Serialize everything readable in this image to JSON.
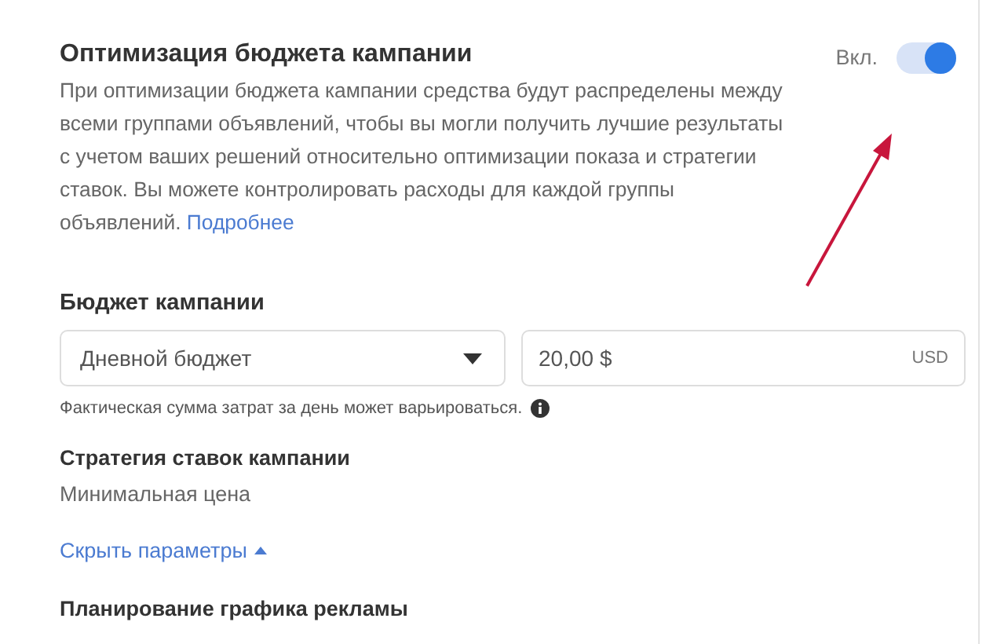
{
  "cbo": {
    "title": "Оптимизация бюджета кампании",
    "toggle_label": "Вкл.",
    "on": true,
    "description": "При оптимизации бюджета кампании средства будут распределены между всеми группами объявлений, чтобы вы могли получить лучшие результаты с учетом ваших решений относительно оптимизации показа и стратегии ставок. Вы можете контролировать расходы для каждой группы объявлений.",
    "link": "Подробнее"
  },
  "budget": {
    "title": "Бюджет кампании",
    "type_value": "Дневной бюджет",
    "amount_value": "20,00 $",
    "currency": "USD",
    "note": "Фактическая сумма затрат за день может варьироваться."
  },
  "bid_strategy": {
    "title": "Стратегия ставок кампании",
    "value": "Минимальная цена"
  },
  "hide_link": "Скрыть параметры",
  "schedule": {
    "title": "Планирование графика рекламы"
  }
}
